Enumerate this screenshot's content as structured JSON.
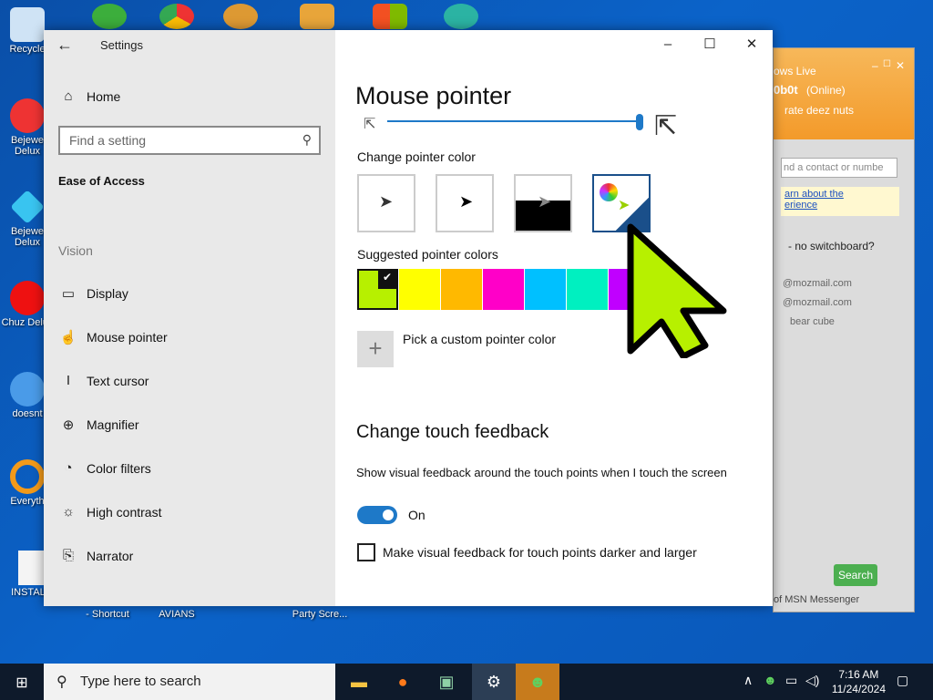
{
  "desktop": {
    "icons": [
      {
        "label": "Recycle"
      },
      {
        "label": "Bejewe Delux"
      },
      {
        "label": "Bejewe Delux"
      },
      {
        "label": "Chuz Delux"
      },
      {
        "label": "doesnt"
      },
      {
        "label": "Everyth"
      },
      {
        "label": "INSTALL"
      }
    ],
    "bottom_labels": [
      "- Shortcut",
      "AVIANS",
      "Party Scre..."
    ]
  },
  "settings": {
    "title": "Settings",
    "home": "Home",
    "search_placeholder": "Find a setting",
    "category": "Ease of Access",
    "section": "Vision",
    "nav": [
      {
        "label": "Display",
        "icon": "monitor-icon"
      },
      {
        "label": "Mouse pointer",
        "icon": "hand-pointer-icon"
      },
      {
        "label": "Text cursor",
        "icon": "text-cursor-icon"
      },
      {
        "label": "Magnifier",
        "icon": "magnifier-icon"
      },
      {
        "label": "Color filters",
        "icon": "palette-icon"
      },
      {
        "label": "High contrast",
        "icon": "sun-icon"
      },
      {
        "label": "Narrator",
        "icon": "narrator-icon"
      }
    ],
    "page_title": "Mouse pointer",
    "change_color_label": "Change pointer color",
    "suggested_label": "Suggested pointer colors",
    "custom_color_label": "Pick a custom pointer color",
    "touch_title": "Change touch feedback",
    "touch_desc": "Show visual feedback around the touch points when I touch the screen",
    "toggle_state": "On",
    "darker_label": "Make visual feedback for touch points darker and larger",
    "size_slider_value": 0.98,
    "swatch_colors": [
      "#b7f000",
      "#ffff00",
      "#ffb900",
      "#ff00c8",
      "#00c0ff",
      "#00f0c0",
      "#c000ff"
    ]
  },
  "msn": {
    "title": "ows Live",
    "user": "0b0t",
    "status": "(Online)",
    "message": "rate deez nuts",
    "search_placeholder": "nd a contact or numbe",
    "link1": "arn about the",
    "link2": "erience",
    "note": "- no switchboard?",
    "contact1": "@mozmail.com",
    "contact2": "@mozmail.com",
    "contact3": "bear cube",
    "search_button": "Search",
    "footer": "of MSN Messenger"
  },
  "taskbar": {
    "search_placeholder": "Type here to search",
    "time": "7:16 AM",
    "date": "11/24/2024"
  }
}
